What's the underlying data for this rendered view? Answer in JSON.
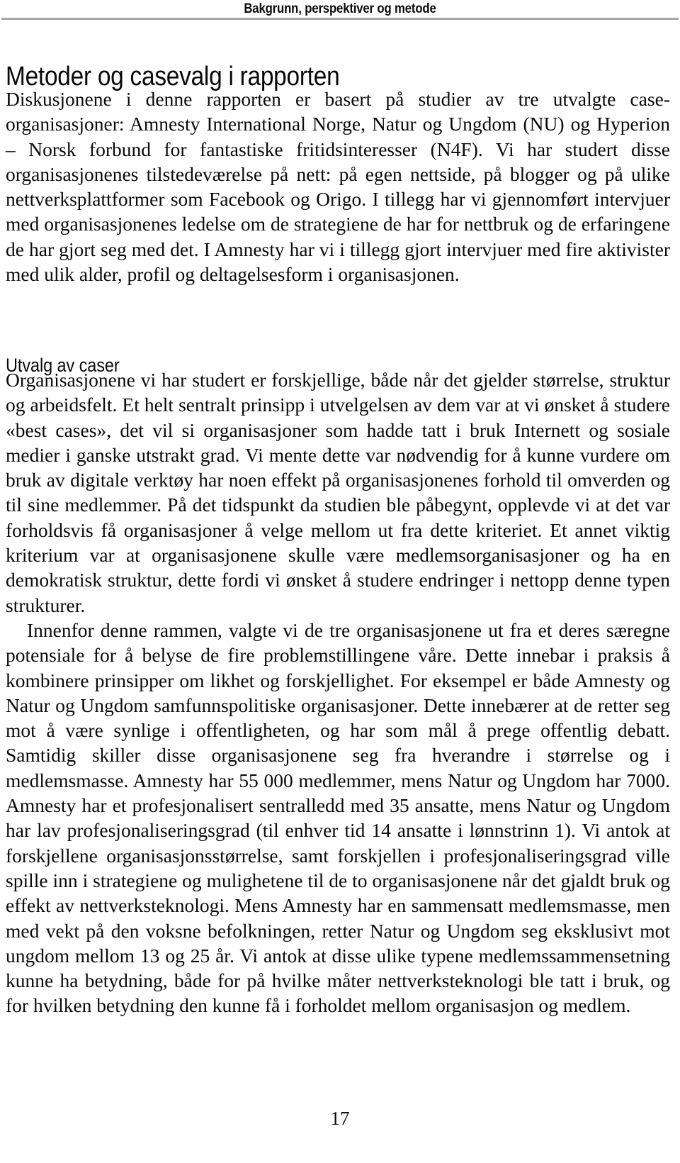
{
  "document": {
    "running_head": "Bakgrunn, perspektiver og metode",
    "page_number": "17",
    "rule_color": "#a6a6a6",
    "text_color": "#0a0a0a",
    "background_color": "#ffffff"
  },
  "chapter": {
    "title": "Metoder og casevalg i rapporten"
  },
  "sections": {
    "intro": {
      "paragraph_1": "Diskusjonene i denne rapporten er basert på studier av tre utvalgte case-organisasjoner: Amnesty International Norge, Natur og Ungdom (NU) og Hyperion – Norsk forbund for fantastiske fritidsinteresser (N4F). Vi har studert disse organisasjonenes tilstedeværelse på nett: på egen nettside, på blogger og på ulike nettverksplattformer som Facebook og Origo. I tillegg har vi gjennomført intervjuer med organisasjonenes ledelse om de strategiene de har for nettbruk og de erfaringene de har gjort seg med det. I Amnesty har vi i tillegg gjort intervjuer med fire aktivister med ulik alder, profil og deltagelsesform i organisasjonen."
    },
    "utvalg": {
      "heading": "Utvalg av caser",
      "paragraph_1": "Organisasjonene vi har studert er forskjellige, både når det gjelder størrelse, struktur og arbeidsfelt. Et helt sentralt prinsipp i utvelgelsen av dem var at vi ønsket å studere «best cases», det vil si organisasjoner som hadde tatt i bruk Internett og sosiale medier i ganske utstrakt grad. Vi mente dette var nødvendig for å kunne vurdere om bruk av digitale verktøy har noen effekt på organisasjonenes forhold til omverden og til sine medlemmer. På det tidspunkt da studien ble påbegynt, opplevde vi at det var forholdsvis få organisasjoner å velge mellom ut fra dette kriteriet. Et annet viktig kriterium var at organisasjonene skulle være medlemsorganisasjoner og ha en demokratisk struktur, dette fordi vi ønsket å studere endringer i nettopp denne typen strukturer.",
      "paragraph_2": "Innenfor denne rammen, valgte vi de tre organisasjonene ut fra et deres særegne potensiale for å belyse de fire problemstillingene våre. Dette innebar i praksis å kombinere prinsipper om likhet og forskjellighet. For eksempel er både Amnesty og Natur og Ungdom samfunnspolitiske organisasjoner. Dette innebærer at de retter seg mot å være synlige i offentligheten, og har som mål å prege offentlig debatt. Samtidig skiller disse organisasjonene seg fra hverandre i størrelse og i medlemsmasse. Amnesty har 55 000 medlemmer, mens Natur og Ungdom har 7000. Amnesty har et profesjonalisert sentralledd med 35 ansatte, mens Natur og Ungdom har lav profesjonaliseringsgrad (til enhver tid 14 ansatte i lønnstrinn 1). Vi antok at forskjellene organisasjonsstørrelse, samt forskjellen i profesjonaliseringsgrad ville spille inn i strategiene og mulighetene til de to organisasjonene når det gjaldt bruk og effekt av nettverksteknologi. Mens Amnesty har en sammensatt medlemsmasse, men med vekt på den voksne befolkningen, retter Natur og Ungdom seg eksklusivt mot ungdom mellom 13 og 25 år. Vi antok at disse ulike typene medlemssammensetning kunne ha betydning, både for på hvilke måter nettverksteknologi ble tatt i bruk, og for hvilken betydning den kunne få i forholdet mellom organisasjon og medlem."
    }
  },
  "figures": {
    "membership_counts": {
      "amnesty_members": "55 000",
      "natur_og_ungdom_members": "7000",
      "amnesty_employees": "35",
      "natur_og_ungdom_employees": "14",
      "natur_og_ungdom_pay_grade": "1",
      "natur_og_ungdom_age_min": "13",
      "natur_og_ungdom_age_max": "25"
    }
  }
}
